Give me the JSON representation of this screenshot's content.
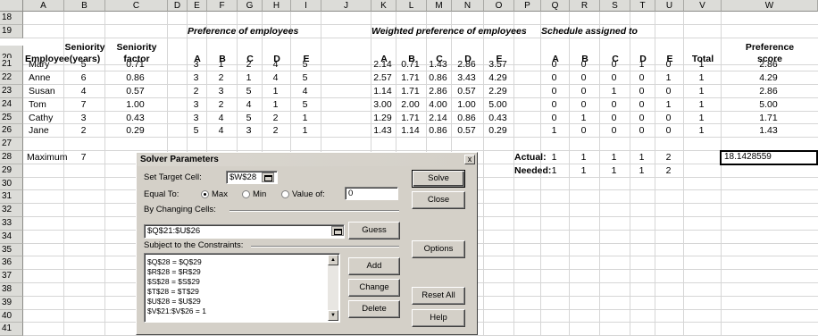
{
  "columns": [
    "A",
    "B",
    "C",
    "D",
    "E",
    "F",
    "G",
    "H",
    "I",
    "J",
    "K",
    "L",
    "M",
    "N",
    "O",
    "P",
    "Q",
    "R",
    "S",
    "T",
    "U",
    "V",
    "W"
  ],
  "rows": [
    "18",
    "19",
    "20",
    "21",
    "22",
    "23",
    "24",
    "25",
    "26",
    "27",
    "28",
    "29",
    "30",
    "31",
    "32",
    "33",
    "34",
    "35",
    "36",
    "37",
    "38",
    "39",
    "40",
    "41"
  ],
  "headers": {
    "seniority": "Seniority",
    "years": "(years)",
    "seniority2": "Seniority",
    "factor": "factor",
    "employee": "Employee",
    "pref_title": "Preference of employees",
    "weighted_title": "Weighted preference of employees",
    "schedule_title": "Schedule assigned to",
    "total": "Total",
    "pref_score1": "Preference",
    "pref_score2": "score",
    "letters": [
      "A",
      "B",
      "C",
      "D",
      "E"
    ]
  },
  "employees": [
    {
      "name": "Mary",
      "years": "5",
      "factor": "0.71",
      "pref": [
        "3",
        "1",
        "2",
        "4",
        "5"
      ],
      "weighted": [
        "2.14",
        "0.71",
        "1.43",
        "2.86",
        "3.57"
      ],
      "sched": [
        "0",
        "0",
        "0",
        "1",
        "0"
      ],
      "total": "1",
      "score": "2.86"
    },
    {
      "name": "Anne",
      "years": "6",
      "factor": "0.86",
      "pref": [
        "3",
        "2",
        "1",
        "4",
        "5"
      ],
      "weighted": [
        "2.57",
        "1.71",
        "0.86",
        "3.43",
        "4.29"
      ],
      "sched": [
        "0",
        "0",
        "0",
        "0",
        "1"
      ],
      "total": "1",
      "score": "4.29"
    },
    {
      "name": "Susan",
      "years": "4",
      "factor": "0.57",
      "pref": [
        "2",
        "3",
        "5",
        "1",
        "4"
      ],
      "weighted": [
        "1.14",
        "1.71",
        "2.86",
        "0.57",
        "2.29"
      ],
      "sched": [
        "0",
        "0",
        "1",
        "0",
        "0"
      ],
      "total": "1",
      "score": "2.86"
    },
    {
      "name": "Tom",
      "years": "7",
      "factor": "1.00",
      "pref": [
        "3",
        "2",
        "4",
        "1",
        "5"
      ],
      "weighted": [
        "3.00",
        "2.00",
        "4.00",
        "1.00",
        "5.00"
      ],
      "sched": [
        "0",
        "0",
        "0",
        "0",
        "1"
      ],
      "total": "1",
      "score": "5.00"
    },
    {
      "name": "Cathy",
      "years": "3",
      "factor": "0.43",
      "pref": [
        "3",
        "4",
        "5",
        "2",
        "1"
      ],
      "weighted": [
        "1.29",
        "1.71",
        "2.14",
        "0.86",
        "0.43"
      ],
      "sched": [
        "0",
        "1",
        "0",
        "0",
        "0"
      ],
      "total": "1",
      "score": "1.71"
    },
    {
      "name": "Jane",
      "years": "2",
      "factor": "0.29",
      "pref": [
        "5",
        "4",
        "3",
        "2",
        "1"
      ],
      "weighted": [
        "1.43",
        "1.14",
        "0.86",
        "0.57",
        "0.29"
      ],
      "sched": [
        "1",
        "0",
        "0",
        "0",
        "0"
      ],
      "total": "1",
      "score": "1.43"
    }
  ],
  "maximum": {
    "label": "Maximum",
    "value": "7"
  },
  "actual": {
    "label": "Actual:",
    "values": [
      "1",
      "1",
      "1",
      "1",
      "2"
    ]
  },
  "needed": {
    "label": "Needed:",
    "values": [
      "1",
      "1",
      "1",
      "1",
      "2"
    ]
  },
  "objective_value": "18.1428559",
  "dialog": {
    "title": "Solver Parameters",
    "close": "x",
    "target_label": "Set Target Cell:",
    "target_value": "$W$28",
    "equal_to_label": "Equal To:",
    "max_label": "Max",
    "min_label": "Min",
    "value_of_label": "Value of:",
    "value_of_value": "0",
    "changing_label": "By Changing Cells:",
    "changing_value": "$Q$21:$U$26",
    "constraints_label": "Subject to the Constraints:",
    "constraints": [
      "$Q$28 = $Q$29",
      "$R$28 = $R$29",
      "$S$28 = $S$29",
      "$T$28 = $T$29",
      "$U$28 = $U$29",
      "$V$21:$V$26 = 1"
    ],
    "buttons": {
      "solve": "Solve",
      "close": "Close",
      "guess": "Guess",
      "options": "Options",
      "add": "Add",
      "change": "Change",
      "delete": "Delete",
      "reset": "Reset All",
      "help": "Help"
    }
  }
}
